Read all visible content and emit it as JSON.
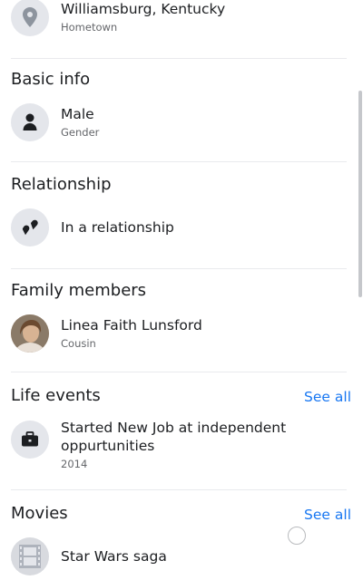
{
  "hometown": {
    "value": "Williamsburg, Kentucky",
    "label": "Hometown",
    "icon": "location-pin-icon"
  },
  "basic_info": {
    "title": "Basic info",
    "gender_value": "Male",
    "gender_label": "Gender",
    "icon": "person-icon"
  },
  "relationship": {
    "title": "Relationship",
    "status": "In a relationship",
    "icon": "hearts-icon"
  },
  "family": {
    "title": "Family members",
    "member_name": "Linea Faith Lunsford",
    "member_relation": "Cousin"
  },
  "life_events": {
    "title": "Life events",
    "see_all": "See all",
    "event_title": "Started New Job at independent oppurtunities",
    "event_year": "2014",
    "icon": "briefcase-icon"
  },
  "movies": {
    "title": "Movies",
    "see_all": "See all",
    "movie_title": "Star Wars saga",
    "icon": "film-icon"
  },
  "colors": {
    "link": "#1877f2",
    "icon_bg": "#e4e6eb",
    "text_primary": "#1c1e21",
    "text_secondary": "#65676b"
  }
}
